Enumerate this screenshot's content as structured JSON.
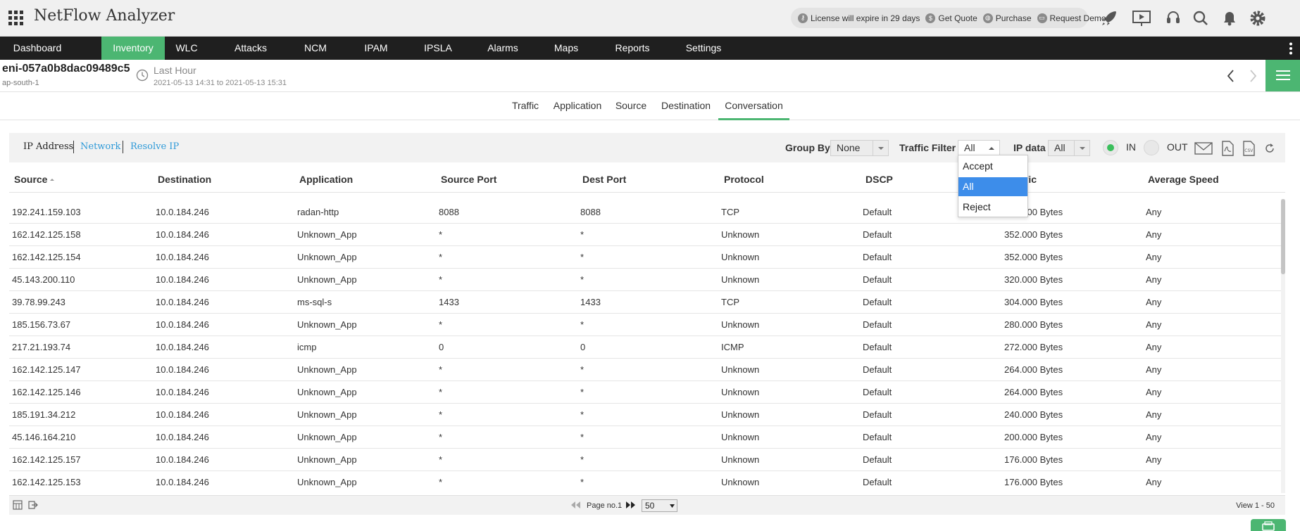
{
  "header": {
    "title": "NetFlow Analyzer",
    "license": [
      {
        "icon": "license-icon",
        "text": "License will expire in 29 days"
      },
      {
        "icon": "quote-icon",
        "text": "Get Quote"
      },
      {
        "icon": "purchase-icon",
        "text": "Purchase"
      },
      {
        "icon": "demo-icon",
        "text": "Request Demo"
      }
    ],
    "icons": [
      "rocket-icon",
      "presentation-icon",
      "support-icon",
      "search-icon",
      "bell-icon",
      "gear-icon"
    ]
  },
  "nav": {
    "items": [
      "Dashboard",
      "Inventory",
      "WLC",
      "Attacks",
      "NCM",
      "IPAM",
      "IPSLA",
      "Alarms",
      "Maps",
      "Reports",
      "Settings"
    ],
    "active": "Inventory"
  },
  "device": {
    "name": "eni-057a0b8dac09489c5",
    "region": "ap-south-1",
    "time_label": "Last Hour",
    "time_range": "2021-05-13 14:31 to 2021-05-13 15:31"
  },
  "tabs": {
    "items": [
      "Traffic",
      "Application",
      "Source",
      "Destination",
      "Conversation"
    ],
    "active": "Conversation"
  },
  "toolbar": {
    "ip_address": "IP Address",
    "network": "Network",
    "resolve_ip": "Resolve IP",
    "group_by_label": "Group By",
    "group_by_value": "None",
    "traffic_filter_label": "Traffic Filter",
    "traffic_filter_value": "All",
    "ip_data_label": "IP data",
    "ip_data_value": "All",
    "in_label": "IN",
    "out_label": "OUT"
  },
  "dropdown": {
    "options": [
      "Accept",
      "All",
      "Reject"
    ],
    "selected": "All"
  },
  "table": {
    "columns": [
      "Source",
      "Destination",
      "Application",
      "Source Port",
      "Dest Port",
      "Protocol",
      "DSCP",
      "Traffic",
      "Average Speed"
    ],
    "rows": [
      [
        "192.241.159.103",
        "10.0.184.246",
        "radan-http",
        "8088",
        "8088",
        "TCP",
        "Default",
        "360.000 Bytes",
        "Any"
      ],
      [
        "162.142.125.158",
        "10.0.184.246",
        "Unknown_App",
        "*",
        "*",
        "Unknown",
        "Default",
        "352.000 Bytes",
        "Any"
      ],
      [
        "162.142.125.154",
        "10.0.184.246",
        "Unknown_App",
        "*",
        "*",
        "Unknown",
        "Default",
        "352.000 Bytes",
        "Any"
      ],
      [
        "45.143.200.110",
        "10.0.184.246",
        "Unknown_App",
        "*",
        "*",
        "Unknown",
        "Default",
        "320.000 Bytes",
        "Any"
      ],
      [
        "39.78.99.243",
        "10.0.184.246",
        "ms-sql-s",
        "1433",
        "1433",
        "TCP",
        "Default",
        "304.000 Bytes",
        "Any"
      ],
      [
        "185.156.73.67",
        "10.0.184.246",
        "Unknown_App",
        "*",
        "*",
        "Unknown",
        "Default",
        "280.000 Bytes",
        "Any"
      ],
      [
        "217.21.193.74",
        "10.0.184.246",
        "icmp",
        "0",
        "0",
        "ICMP",
        "Default",
        "272.000 Bytes",
        "Any"
      ],
      [
        "162.142.125.147",
        "10.0.184.246",
        "Unknown_App",
        "*",
        "*",
        "Unknown",
        "Default",
        "264.000 Bytes",
        "Any"
      ],
      [
        "162.142.125.146",
        "10.0.184.246",
        "Unknown_App",
        "*",
        "*",
        "Unknown",
        "Default",
        "264.000 Bytes",
        "Any"
      ],
      [
        "185.191.34.212",
        "10.0.184.246",
        "Unknown_App",
        "*",
        "*",
        "Unknown",
        "Default",
        "240.000 Bytes",
        "Any"
      ],
      [
        "45.146.164.210",
        "10.0.184.246",
        "Unknown_App",
        "*",
        "*",
        "Unknown",
        "Default",
        "200.000 Bytes",
        "Any"
      ],
      [
        "162.142.125.157",
        "10.0.184.246",
        "Unknown_App",
        "*",
        "*",
        "Unknown",
        "Default",
        "176.000 Bytes",
        "Any"
      ],
      [
        "162.142.125.153",
        "10.0.184.246",
        "Unknown_App",
        "*",
        "*",
        "Unknown",
        "Default",
        "176.000 Bytes",
        "Any"
      ]
    ]
  },
  "pager": {
    "page_text": "Page no.1",
    "page_size": "50",
    "view_text": "View 1 - 50"
  },
  "colors": {
    "accent": "#4cb672",
    "nav_bg": "#1f1f1f",
    "link": "#2e9ad8",
    "dropdown_selected": "#3d8dea"
  }
}
